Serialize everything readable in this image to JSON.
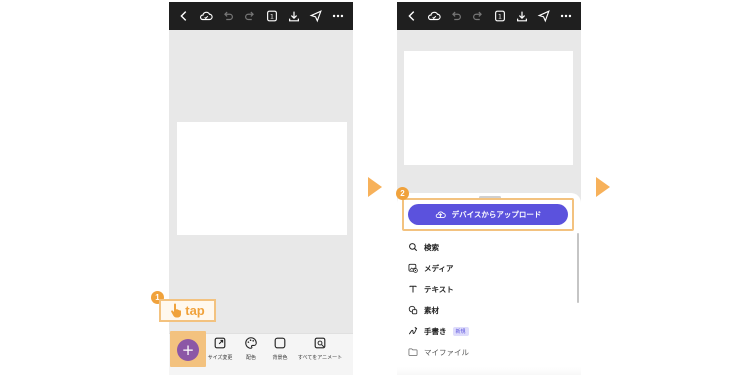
{
  "colors": {
    "topbar_bg": "#1f1f1f",
    "highlight": "#f3c27f",
    "step_badge": "#f0a23c",
    "arrow": "#f7b15a",
    "fab": "#8c57a6",
    "upload_button": "#5b52dd"
  },
  "topbar_icons": [
    "back-icon",
    "cloud-sync-icon",
    "undo-icon",
    "redo-icon",
    "pages-icon",
    "download-icon",
    "share-icon",
    "more-icon"
  ],
  "step1": {
    "badge": "1",
    "tap_label": "tap",
    "fab_symbol": "+",
    "toolbar": [
      {
        "label": "サイズ変更",
        "icon": "resize-icon"
      },
      {
        "label": "配色",
        "icon": "palette-icon"
      },
      {
        "label": "背景色",
        "icon": "background-color-icon"
      },
      {
        "label": "すべてをアニメート",
        "icon": "animate-icon"
      }
    ]
  },
  "step2": {
    "badge": "2",
    "upload_label": "デバイスからアップロード",
    "menu": [
      {
        "label": "検索",
        "icon": "search-icon"
      },
      {
        "label": "メディア",
        "icon": "media-icon"
      },
      {
        "label": "テキスト",
        "icon": "text-icon"
      },
      {
        "label": "素材",
        "icon": "elements-icon"
      },
      {
        "label": "手書き",
        "icon": "draw-icon",
        "badge": "新規"
      },
      {
        "label": "マイファイル",
        "icon": "folder-icon"
      }
    ]
  }
}
